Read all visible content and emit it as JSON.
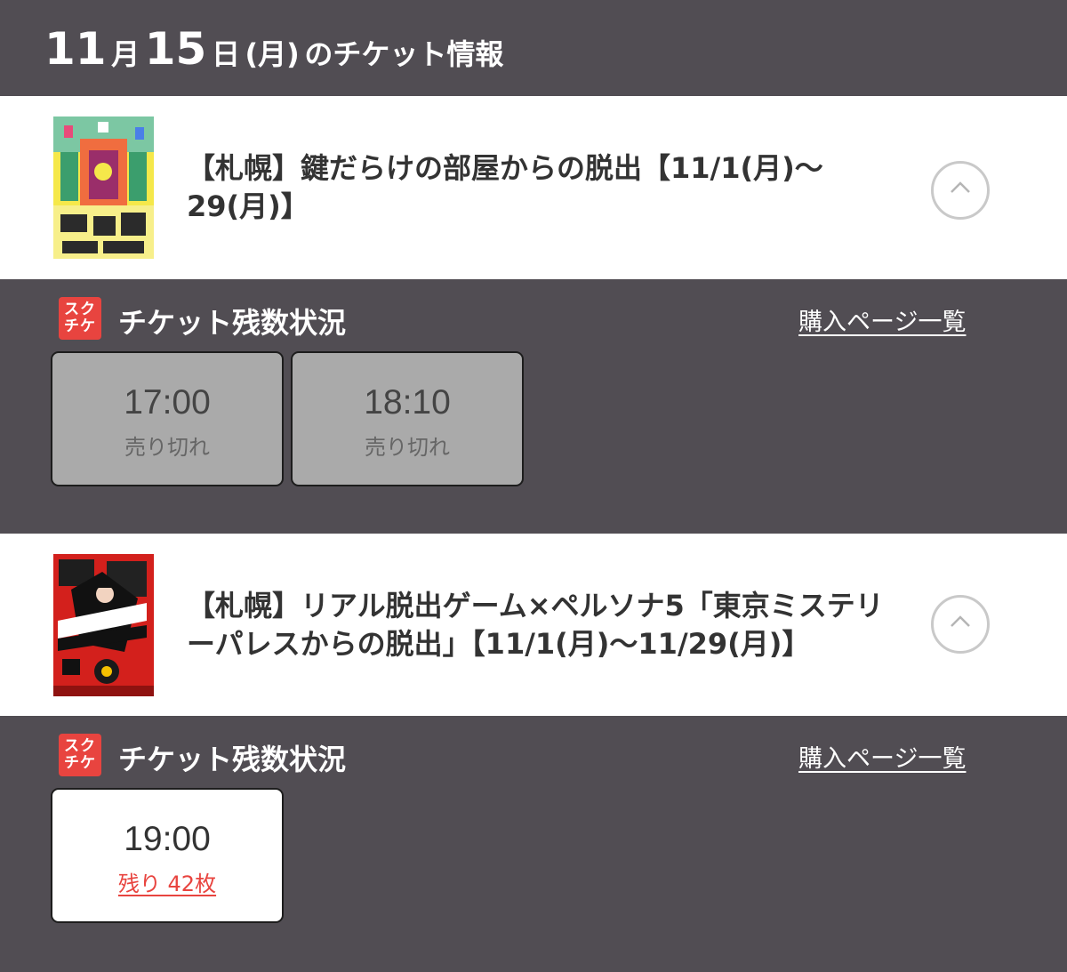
{
  "header": {
    "month": "11",
    "month_unit": "月",
    "day": "15",
    "day_unit": "日",
    "weekday": "(月)",
    "suffix": "のチケット情報"
  },
  "events": [
    {
      "title": "【札幌】鍵だらけの部屋からの脱出【11/1(月)〜29(月)】",
      "poster_icon": "escape-room-keys-poster",
      "status_logo": "スクチケ",
      "status_heading": "チケット残数状況",
      "purchase_link": "購入ページ一覧",
      "slots": [
        {
          "time": "17:00",
          "state": "売り切れ"
        },
        {
          "time": "18:10",
          "state": "売り切れ"
        }
      ]
    },
    {
      "title": "【札幌】リアル脱出ゲーム×ペルソナ5「東京ミステリーパレスからの脱出」【11/1(月)〜11/29(月)】",
      "poster_icon": "persona5-escape-poster",
      "status_logo": "スクチケ",
      "status_heading": "チケット残数状況",
      "purchase_link": "購入ページ一覧",
      "slots": [
        {
          "time": "19:00",
          "state": "残り 42枚"
        }
      ]
    }
  ],
  "colors": {
    "background": "#514d53",
    "accent": "#e8443f",
    "sold_out": "#aaaaaa"
  }
}
